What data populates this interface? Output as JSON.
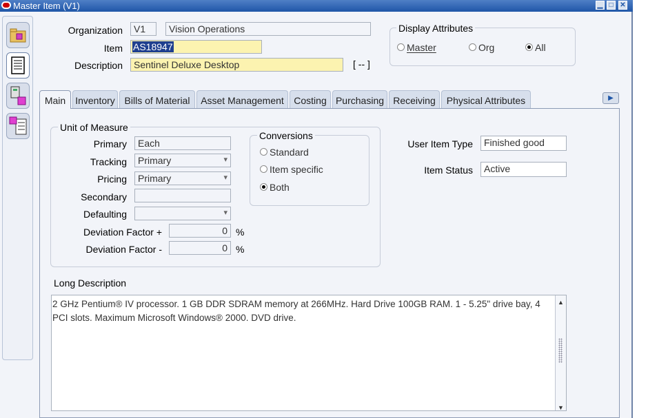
{
  "window": {
    "title": "Master Item (V1)"
  },
  "header": {
    "organization_label": "Organization",
    "organization_code": "V1",
    "organization_name": "Vision Operations",
    "item_label": "Item",
    "item_value": "AS18947",
    "description_label": "Description",
    "description_value": "Sentinel Deluxe Desktop",
    "flex_button": "[ -- ]"
  },
  "display_attributes": {
    "title": "Display Attributes",
    "options": [
      "Master",
      "Org",
      "All"
    ],
    "selected": "All"
  },
  "tabs": [
    "Main",
    "Inventory",
    "Bills of Material",
    "Asset Management",
    "Costing",
    "Purchasing",
    "Receiving",
    "Physical Attributes"
  ],
  "active_tab": "Main",
  "uom": {
    "title": "Unit of Measure",
    "primary_label": "Primary",
    "primary_value": "Each",
    "tracking_label": "Tracking",
    "tracking_value": "Primary",
    "pricing_label": "Pricing",
    "pricing_value": "Primary",
    "secondary_label": "Secondary",
    "secondary_value": "",
    "defaulting_label": "Defaulting",
    "defaulting_value": "",
    "dev_plus_label": "Deviation Factor +",
    "dev_plus_value": "0",
    "dev_minus_label": "Deviation Factor -",
    "dev_minus_value": "0",
    "percent": "%"
  },
  "conversions": {
    "title": "Conversions",
    "options": [
      "Standard",
      "Item specific",
      "Both"
    ],
    "selected": "Both"
  },
  "item_info": {
    "user_item_type_label": "User Item Type",
    "user_item_type_value": "Finished good",
    "item_status_label": "Item Status",
    "item_status_value": "Active"
  },
  "long_description": {
    "label": "Long Description",
    "text": "2 GHz Pentium® IV processor.  1 GB DDR SDRAM memory at 266MHz.  Hard Drive 100GB RAM.  1 - 5.25\" drive bay, 4 PCI slots.  Maximum Microsoft Windows® 2000.  DVD drive."
  },
  "icons": [
    "oracle-logo-icon",
    "minimize-icon",
    "maximize-icon",
    "close-icon",
    "folder-icon",
    "document-list-icon",
    "item-catalog-icon",
    "item-attributes-icon",
    "tab-scroll-right-icon",
    "scroll-up-icon",
    "scroll-down-icon"
  ]
}
